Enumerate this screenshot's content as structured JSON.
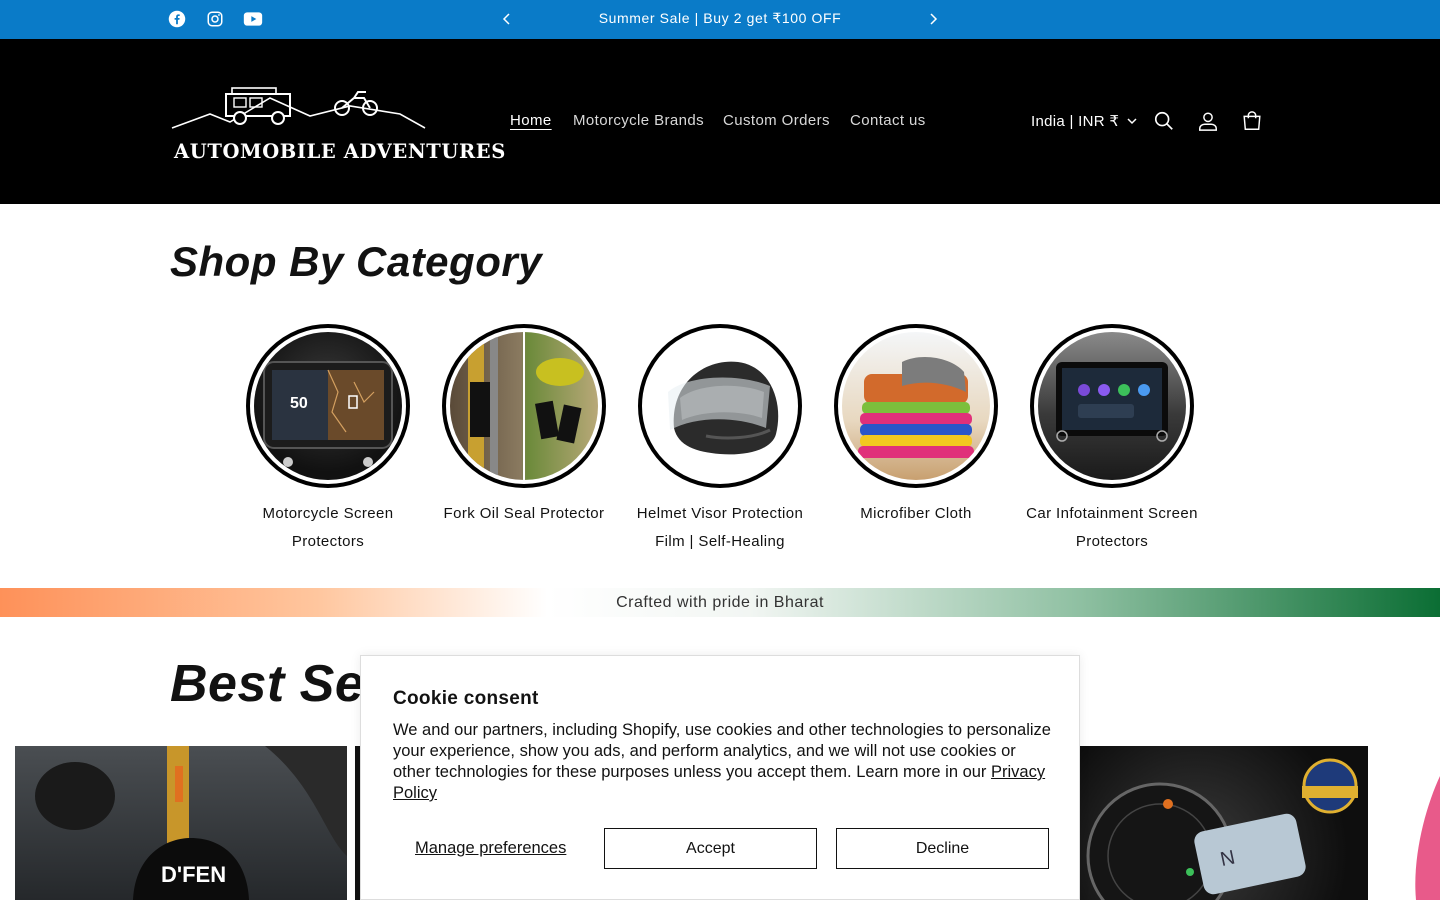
{
  "announcement": {
    "text": "Summer Sale | Buy 2 get ₹100 OFF",
    "social_icons": [
      "facebook-icon",
      "instagram-icon",
      "youtube-icon"
    ]
  },
  "header": {
    "logo_text": "AUTOMOBILE ADVENTURES",
    "nav": [
      "Home",
      "Motorcycle Brands",
      "Custom Orders",
      "Contact us"
    ],
    "active_nav": "Home",
    "country_selector": "India | INR ₹",
    "icons": [
      "search-icon",
      "account-icon",
      "cart-icon"
    ]
  },
  "categories": {
    "title": "Shop By Category",
    "items": [
      {
        "label": "Motorcycle Screen Protectors"
      },
      {
        "label": "Fork Oil Seal Protector"
      },
      {
        "label": "Helmet Visor Protection Film | Self-Healing"
      },
      {
        "label": "Microfiber Cloth"
      },
      {
        "label": "Car Infotainment Screen Protectors"
      }
    ]
  },
  "pride_band": {
    "text": "Crafted with pride in Bharat"
  },
  "best_sellers": {
    "title": "Best Sellers"
  },
  "cookie": {
    "title": "Cookie consent",
    "body": "We and our partners, including Shopify, use cookies and other technologies to personalize your experience, show you ads, and perform analytics, and we will not use cookies or other technologies for these purposes unless you accept them. Learn more in our ",
    "link": "Privacy Policy",
    "manage_label": "Manage preferences",
    "accept_label": "Accept",
    "decline_label": "Decline"
  },
  "colors": {
    "announcement_bg": "#0a7bc8",
    "header_bg": "#000000",
    "pride_saffron": "#fe9159",
    "pride_green": "#0b6e34"
  }
}
